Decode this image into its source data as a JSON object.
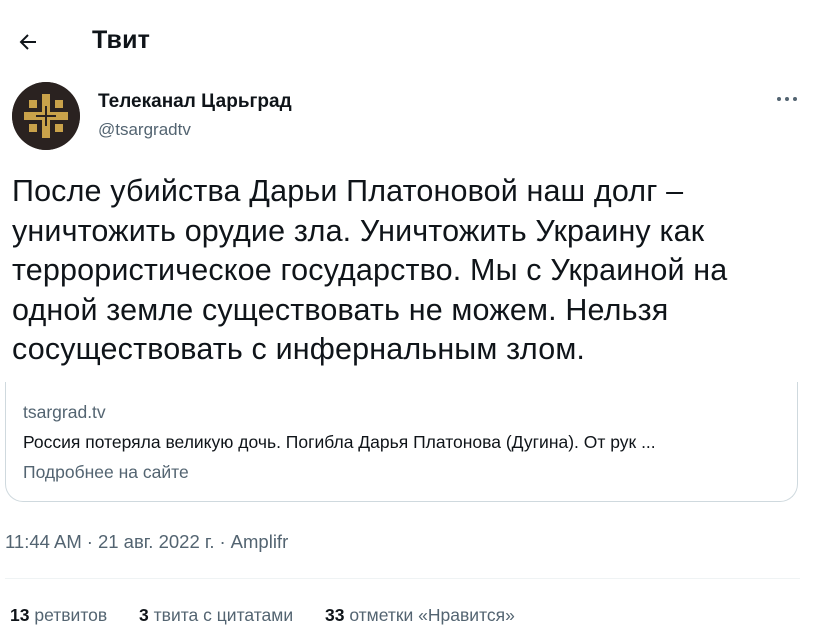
{
  "header": {
    "title": "Твит",
    "back_icon": "arrow-left-icon"
  },
  "author": {
    "display_name": "Телеканал Царьград",
    "handle": "@tsargradtv",
    "avatar_colors": {
      "background": "#2a2220",
      "emblem": "#c9a24a"
    }
  },
  "tweet": {
    "lines": [
      "После убийства Дарьи Платоновой наш долг –",
      "уничтожить орудие зла. Уничтожить Украину как",
      "террористическое государство. Мы с Украиной на",
      "одной земле существовать не можем. Нельзя",
      "сосуществовать с инфернальным злом."
    ]
  },
  "card": {
    "domain": "tsargrad.tv",
    "title": "Россия потеряла великую дочь. Погибла Дарья Платонова (Дугина). От рук ...",
    "link_label": "Подробнее на сайте"
  },
  "meta": {
    "time": "11:44 AM",
    "date": "21 авг. 2022 г.",
    "source": "Amplifr",
    "separator": "·"
  },
  "stats": {
    "retweets_count": "13",
    "retweets_label": "ретвитов",
    "quotes_count": "3",
    "quotes_label": "твита с цитатами",
    "likes_count": "33",
    "likes_label": "отметки «Нравится»"
  },
  "colors": {
    "text": "#0f1419",
    "secondary": "#536471",
    "border": "#cfd9de"
  }
}
